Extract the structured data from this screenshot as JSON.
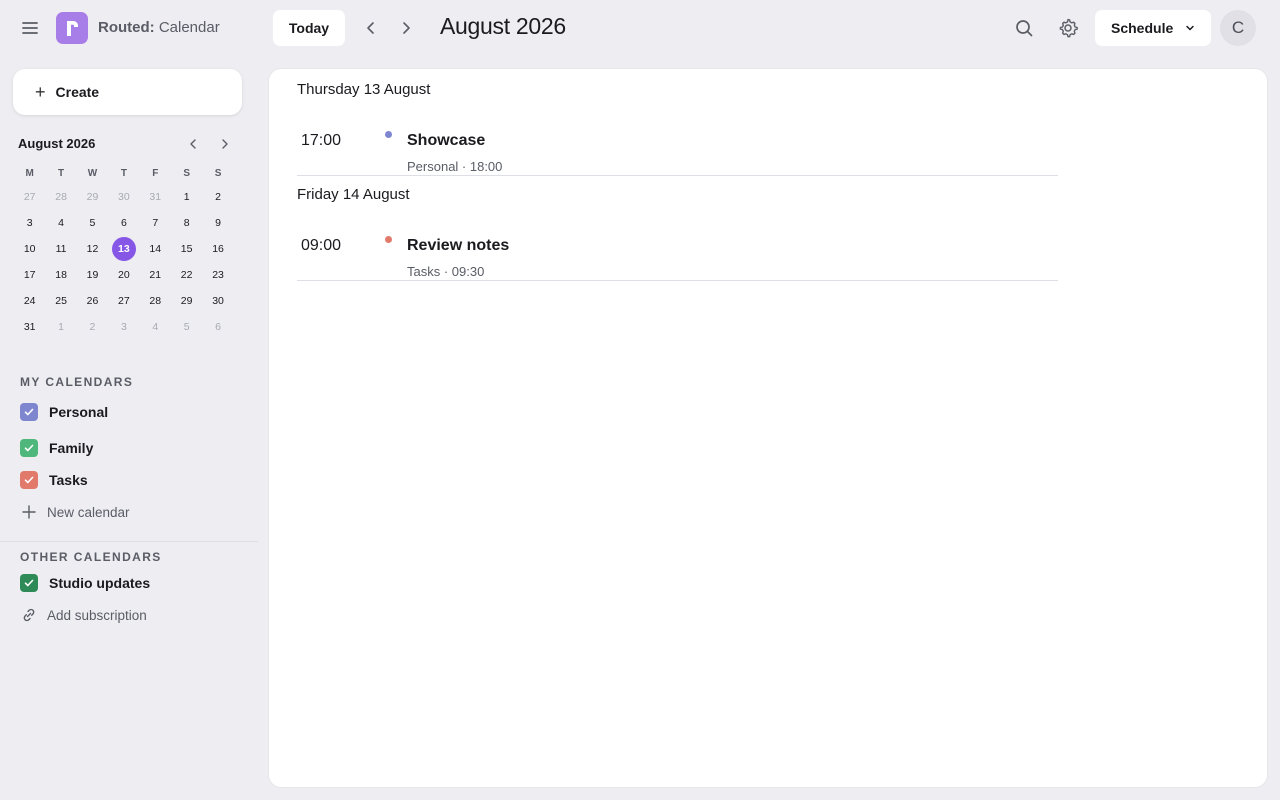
{
  "app": {
    "brand_bold": "Routed:",
    "brand_rest": " Calendar",
    "accent": "#8656e6"
  },
  "toolbar": {
    "today_label": "Today",
    "period_title": "August 2026",
    "view_label": "Schedule",
    "avatar_initial": "C",
    "icons": [
      "menu-icon",
      "chevron-left-icon",
      "chevron-right-icon",
      "search-icon",
      "gear-icon",
      "chevron-down-icon"
    ]
  },
  "sidebar": {
    "create_label": "Create",
    "mini_calendar": {
      "month_label": "August 2026",
      "weekdays": [
        "M",
        "T",
        "W",
        "T",
        "F",
        "S",
        "S"
      ],
      "selected_day": "13",
      "weeks": [
        [
          {
            "d": "27",
            "m": true
          },
          {
            "d": "28",
            "m": true
          },
          {
            "d": "29",
            "m": true
          },
          {
            "d": "30",
            "m": true
          },
          {
            "d": "31",
            "m": true
          },
          {
            "d": "1"
          },
          {
            "d": "2"
          }
        ],
        [
          {
            "d": "3"
          },
          {
            "d": "4"
          },
          {
            "d": "5"
          },
          {
            "d": "6"
          },
          {
            "d": "7"
          },
          {
            "d": "8"
          },
          {
            "d": "9"
          }
        ],
        [
          {
            "d": "10"
          },
          {
            "d": "11"
          },
          {
            "d": "12"
          },
          {
            "d": "13"
          },
          {
            "d": "14"
          },
          {
            "d": "15"
          },
          {
            "d": "16"
          }
        ],
        [
          {
            "d": "17"
          },
          {
            "d": "18"
          },
          {
            "d": "19"
          },
          {
            "d": "20"
          },
          {
            "d": "21"
          },
          {
            "d": "22"
          },
          {
            "d": "23"
          }
        ],
        [
          {
            "d": "24"
          },
          {
            "d": "25"
          },
          {
            "d": "26"
          },
          {
            "d": "27"
          },
          {
            "d": "28"
          },
          {
            "d": "29"
          },
          {
            "d": "30"
          }
        ],
        [
          {
            "d": "31"
          },
          {
            "d": "1",
            "m": true
          },
          {
            "d": "2",
            "m": true
          },
          {
            "d": "3",
            "m": true
          },
          {
            "d": "4",
            "m": true
          },
          {
            "d": "5",
            "m": true
          },
          {
            "d": "6",
            "m": true
          }
        ]
      ]
    },
    "my_calendars_label": "MY CALENDARS",
    "my_calendars": [
      {
        "name": "Personal",
        "color": "#7f86d0",
        "checked": true
      },
      {
        "name": "Family",
        "color": "#4fb77b",
        "checked": true
      },
      {
        "name": "Tasks",
        "color": "#e27a6b",
        "checked": true
      }
    ],
    "new_calendar_label": "New calendar",
    "other_calendars_label": "OTHER CALENDARS",
    "other_calendars": [
      {
        "name": "Studio updates",
        "color": "#2e8b57",
        "checked": true
      }
    ],
    "add_subscription_label": "Add subscription"
  },
  "schedule": {
    "days": [
      {
        "heading": "Thursday 13 August",
        "events": [
          {
            "time": "17:00",
            "title": "Showcase",
            "meta": "Personal · 18:00",
            "color": "#7f86d0"
          }
        ]
      },
      {
        "heading": "Friday 14 August",
        "events": [
          {
            "time": "09:00",
            "title": "Review notes",
            "meta": "Tasks · 09:30",
            "color": "#e27a6b"
          }
        ]
      }
    ]
  }
}
